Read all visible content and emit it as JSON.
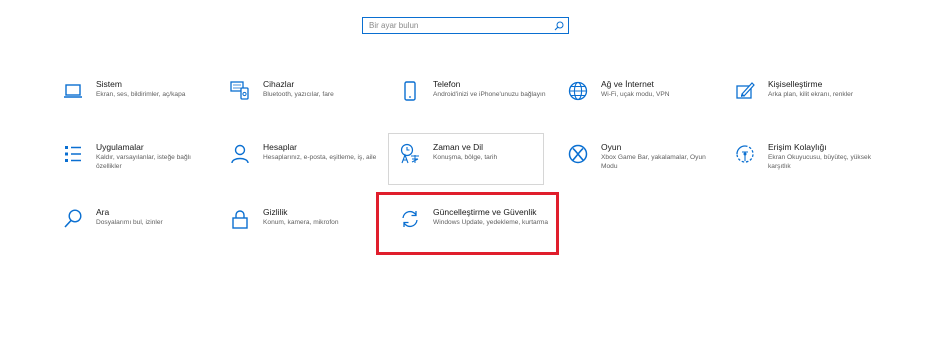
{
  "search": {
    "placeholder": "Bir ayar bulun",
    "icon": "search-icon"
  },
  "accent": "#0a6fd1",
  "highlight_color": "#e01e2c",
  "tiles": [
    {
      "title": "Sistem",
      "desc": "Ekran, ses, bildirimler, aç/kapa",
      "icon": "laptop-icon"
    },
    {
      "title": "Cihazlar",
      "desc": "Bluetooth, yazıcılar, fare",
      "icon": "devices-icon"
    },
    {
      "title": "Telefon",
      "desc": "Android'inizi ve iPhone'unuzu bağlayın",
      "icon": "phone-icon"
    },
    {
      "title": "Ağ ve İnternet",
      "desc": "Wi-Fi, uçak modu, VPN",
      "icon": "globe-icon"
    },
    {
      "title": "Kişiselleştirme",
      "desc": "Arka plan, kilit ekranı, renkler",
      "icon": "personalization-icon"
    },
    {
      "title": "Uygulamalar",
      "desc": "Kaldır, varsayılanlar, isteğe bağlı özellikler",
      "icon": "apps-list-icon"
    },
    {
      "title": "Hesaplar",
      "desc": "Hesaplarınız, e-posta, eşitleme, iş, aile",
      "icon": "person-icon"
    },
    {
      "title": "Zaman ve Dil",
      "desc": "Konuşma, bölge, tarih",
      "icon": "time-language-icon"
    },
    {
      "title": "Oyun",
      "desc": "Xbox Game Bar, yakalamalar, Oyun Modu",
      "icon": "xbox-icon"
    },
    {
      "title": "Erişim Kolaylığı",
      "desc": "Ekran Okuyucusu, büyüteç, yüksek karşıtlık",
      "icon": "ease-of-access-icon"
    },
    {
      "title": "Ara",
      "desc": "Dosyalarımı bul, izinler",
      "icon": "search-icon"
    },
    {
      "title": "Gizlilik",
      "desc": "Konum, kamera, mikrofon",
      "icon": "lock-icon"
    },
    {
      "title": "Güncelleştirme ve Güvenlik",
      "desc": "Windows Update, yedekleme, kurtarma",
      "icon": "sync-icon"
    }
  ]
}
